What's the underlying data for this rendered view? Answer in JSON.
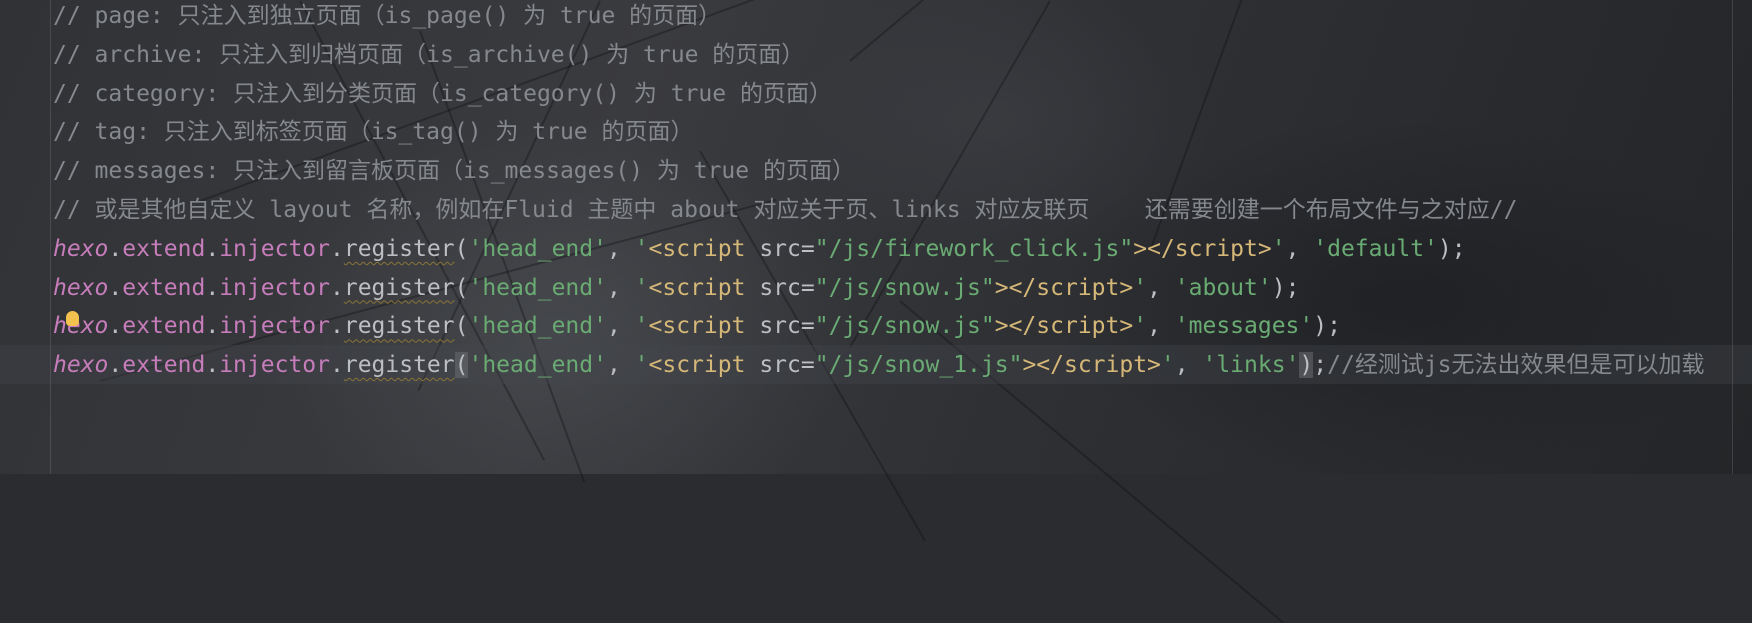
{
  "editor": {
    "lines": [
      [
        {
          "t": "comment",
          "v": "// page: 只注入到独立页面（is_page() 为 true 的页面）"
        }
      ],
      [
        {
          "t": "comment",
          "v": "// archive: 只注入到归档页面（is_archive() 为 true 的页面）"
        }
      ],
      [
        {
          "t": "comment",
          "v": "// category: 只注入到分类页面（is_category() 为 true 的页面）"
        }
      ],
      [
        {
          "t": "comment",
          "v": "// tag: 只注入到标签页面（is_tag() 为 true 的页面）"
        }
      ],
      [
        {
          "t": "comment",
          "v": "// messages: 只注入到留言板页面（is_messages() 为 true 的页面）"
        }
      ],
      [
        {
          "t": "comment",
          "v": "// 或是其他自定义 layout 名称，例如在Fluid 主题中 about 对应关于页、links 对应友联页    还需要创建一个布局文件与之对应//"
        }
      ],
      [
        {
          "t": "kw-obj",
          "v": "hexo"
        },
        {
          "t": "punc",
          "v": "."
        },
        {
          "t": "prop",
          "v": "extend"
        },
        {
          "t": "punc",
          "v": "."
        },
        {
          "t": "prop",
          "v": "injector"
        },
        {
          "t": "punc",
          "v": "."
        },
        {
          "t": "fn",
          "v": "register"
        },
        {
          "t": "punc",
          "v": "("
        },
        {
          "t": "str",
          "v": "'head_end'"
        },
        {
          "t": "punc",
          "v": ", "
        },
        {
          "t": "str",
          "v": "'"
        },
        {
          "t": "tag",
          "v": "<script"
        },
        {
          "t": "attr",
          "v": " src="
        },
        {
          "t": "str",
          "v": "\"/js/firework_click.js\""
        },
        {
          "t": "tag",
          "v": "></script>"
        },
        {
          "t": "str",
          "v": "'"
        },
        {
          "t": "punc",
          "v": ", "
        },
        {
          "t": "str",
          "v": "'default'"
        },
        {
          "t": "punc",
          "v": ");"
        }
      ],
      [
        {
          "t": "kw-obj",
          "v": "hexo"
        },
        {
          "t": "punc",
          "v": "."
        },
        {
          "t": "prop",
          "v": "extend"
        },
        {
          "t": "punc",
          "v": "."
        },
        {
          "t": "prop",
          "v": "injector"
        },
        {
          "t": "punc",
          "v": "."
        },
        {
          "t": "fn",
          "v": "register"
        },
        {
          "t": "punc",
          "v": "("
        },
        {
          "t": "str",
          "v": "'head_end'"
        },
        {
          "t": "punc",
          "v": ", "
        },
        {
          "t": "str",
          "v": "'"
        },
        {
          "t": "tag",
          "v": "<script"
        },
        {
          "t": "attr",
          "v": " src="
        },
        {
          "t": "str",
          "v": "\"/js/snow.js\""
        },
        {
          "t": "tag",
          "v": "></script>"
        },
        {
          "t": "str",
          "v": "'"
        },
        {
          "t": "punc",
          "v": ", "
        },
        {
          "t": "str",
          "v": "'about'"
        },
        {
          "t": "punc",
          "v": ");"
        }
      ],
      [
        {
          "t": "kw-obj",
          "v": "hexo"
        },
        {
          "t": "punc",
          "v": "."
        },
        {
          "t": "prop",
          "v": "extend"
        },
        {
          "t": "punc",
          "v": "."
        },
        {
          "t": "prop",
          "v": "injector"
        },
        {
          "t": "punc",
          "v": "."
        },
        {
          "t": "fn",
          "v": "register"
        },
        {
          "t": "punc",
          "v": "("
        },
        {
          "t": "str",
          "v": "'head_end'"
        },
        {
          "t": "punc",
          "v": ", "
        },
        {
          "t": "str",
          "v": "'"
        },
        {
          "t": "tag",
          "v": "<script"
        },
        {
          "t": "attr",
          "v": " src="
        },
        {
          "t": "str",
          "v": "\"/js/snow.js\""
        },
        {
          "t": "tag",
          "v": "></script>"
        },
        {
          "t": "str",
          "v": "'"
        },
        {
          "t": "punc",
          "v": ", "
        },
        {
          "t": "str",
          "v": "'messages'"
        },
        {
          "t": "punc",
          "v": ");"
        }
      ],
      [
        {
          "t": "kw-obj",
          "v": "hexo"
        },
        {
          "t": "punc",
          "v": "."
        },
        {
          "t": "prop",
          "v": "extend"
        },
        {
          "t": "punc",
          "v": "."
        },
        {
          "t": "prop",
          "v": "injector"
        },
        {
          "t": "punc",
          "v": "."
        },
        {
          "t": "fn",
          "v": "register"
        },
        {
          "t": "punc paren-hl",
          "v": "("
        },
        {
          "t": "str",
          "v": "'head_end'"
        },
        {
          "t": "punc",
          "v": ", "
        },
        {
          "t": "str",
          "v": "'"
        },
        {
          "t": "tag",
          "v": "<script"
        },
        {
          "t": "attr",
          "v": " src="
        },
        {
          "t": "str",
          "v": "\"/js/snow_1.js\""
        },
        {
          "t": "tag",
          "v": "></script>"
        },
        {
          "t": "str",
          "v": "'"
        },
        {
          "t": "punc",
          "v": ", "
        },
        {
          "t": "str",
          "v": "'links'"
        },
        {
          "t": "punc paren-hl",
          "v": ")"
        },
        {
          "t": "punc",
          "v": ";"
        },
        {
          "t": "comment",
          "v": "//经测试js无法出效果但是可以加载"
        }
      ]
    ],
    "intention_icon": "lightbulb-icon",
    "colors": {
      "comment": "#85888d",
      "keyword": "#c77dbb",
      "string": "#6aab73",
      "tag": "#d5b778",
      "text": "#bcbec4",
      "bulb": "#f2c14e"
    }
  }
}
